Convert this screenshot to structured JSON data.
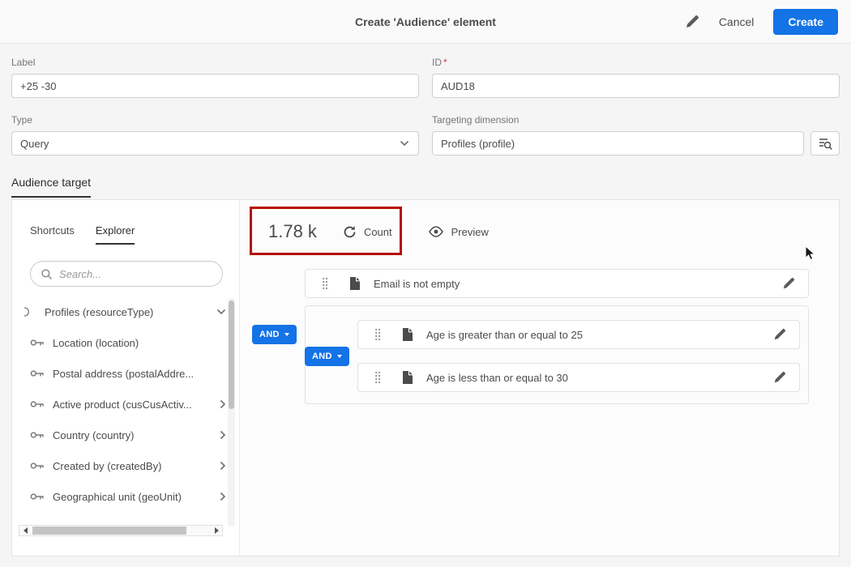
{
  "header": {
    "title": "Create 'Audience' element",
    "cancel_label": "Cancel",
    "create_label": "Create"
  },
  "form": {
    "label_field": {
      "label": "Label",
      "value": "+25 -30"
    },
    "id_field": {
      "label": "ID",
      "required_mark": "*",
      "value": "AUD18"
    },
    "type_field": {
      "label": "Type",
      "value": "Query"
    },
    "targeting_field": {
      "label": "Targeting dimension",
      "value": "Profiles (profile)"
    }
  },
  "section": {
    "audience_tab_label": "Audience target"
  },
  "explorer": {
    "tabs": {
      "shortcuts": "Shortcuts",
      "explorer": "Explorer"
    },
    "search_placeholder": "Search...",
    "items": [
      {
        "label": "Profiles (resourceType)",
        "expanded": true
      },
      {
        "label": "Location (location)"
      },
      {
        "label": "Postal address (postalAddre..."
      },
      {
        "label": "Active product (cusCusActiv...",
        "expandable": true
      },
      {
        "label": "Country (country)",
        "expandable": true
      },
      {
        "label": "Created by (createdBy)",
        "expandable": true
      },
      {
        "label": "Geographical unit (geoUnit)",
        "expandable": true
      }
    ]
  },
  "query": {
    "count_value": "1.78 k",
    "count_label": "Count",
    "preview_label": "Preview",
    "operator": "AND",
    "conditions": [
      {
        "label": "Email is not empty"
      },
      {
        "label": "Age is greater than or equal to 25"
      },
      {
        "label": "Age is less than or equal to 30"
      }
    ]
  },
  "colors": {
    "accent": "#1473e6",
    "annotation": "#b50d00"
  }
}
